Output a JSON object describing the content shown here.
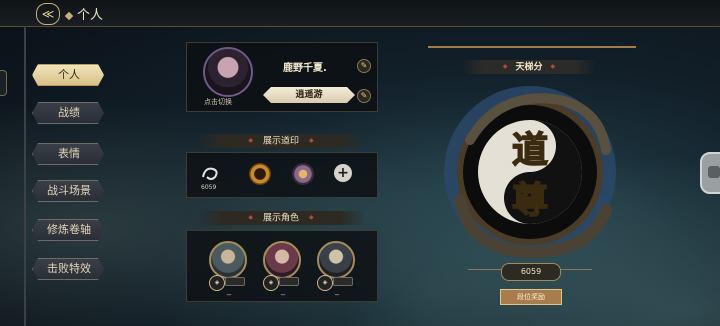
{
  "topbar": {
    "back_icon": "back-arrow-icon",
    "title": "个人"
  },
  "sidebar": {
    "items": [
      {
        "label": "个人",
        "active": true
      },
      {
        "label": "战绩",
        "active": false
      },
      {
        "label": "表情",
        "active": false
      },
      {
        "label": "战斗场景",
        "active": false
      },
      {
        "label": "修炼卷轴",
        "active": false
      },
      {
        "label": "击败特效",
        "active": false
      }
    ]
  },
  "profile": {
    "avatar_hint": "点击切换",
    "name": "鹿野千夏.",
    "title_badge": "逍遥游",
    "edit_icon": "pencil-icon"
  },
  "seals_section": {
    "title": "展示道印",
    "seal_value": "6059",
    "add_icon": "plus-icon"
  },
  "roles_section": {
    "title": "展示角色"
  },
  "rank": {
    "title": "天梯分",
    "emblem_text_top": "道",
    "emblem_text_bottom": "尊",
    "score": "6059",
    "button_label": "段位奖励"
  },
  "colors": {
    "accent_gold": "#c9b07a",
    "section_marker": "#b24a38",
    "nav_active": "#e6d4a0"
  }
}
